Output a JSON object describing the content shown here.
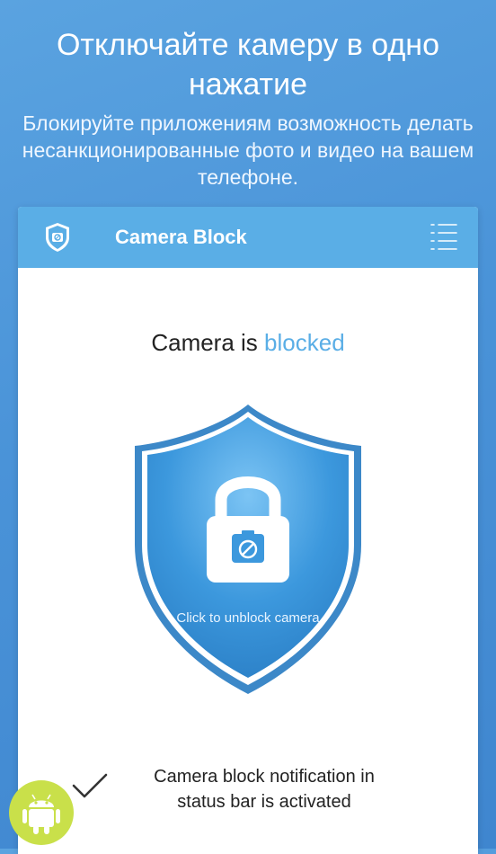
{
  "promo": {
    "title": "Отключайте камеру в одно нажатие",
    "subtitle": "Блокируйте приложениям возможность делать несанкционированные фото и видео на вашем телефоне."
  },
  "app": {
    "title": "Camera Block",
    "status_prefix": "Camera is ",
    "status_value": "blocked",
    "unlock_label": "Click to unblock camera",
    "notification_text": "Camera block notification in status bar is activated"
  },
  "colors": {
    "background": "#4a93d8",
    "app_bar": "#5aaee6",
    "accent": "#5aaee6",
    "shield": "#3c98dd",
    "android_badge": "#c9e04a"
  },
  "icons": [
    "camera-shield-logo-icon",
    "menu-list-icon",
    "padlock-icon",
    "camera-blocked-icon",
    "checkmark-icon",
    "android-icon"
  ]
}
